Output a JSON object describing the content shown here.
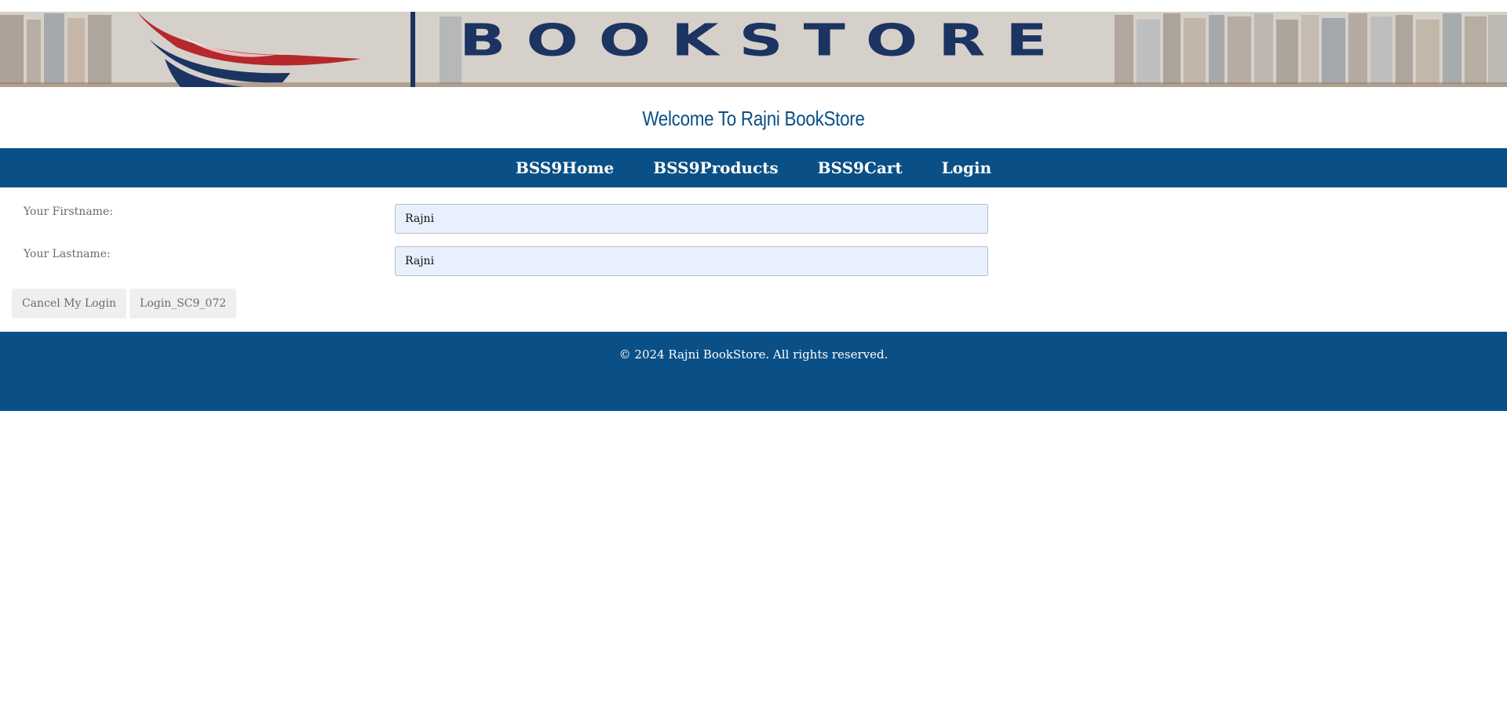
{
  "banner": {
    "logo_text": "BOOKSTORE",
    "colors": {
      "navy": "#1b3462",
      "red": "#b5282c"
    }
  },
  "welcome": {
    "title": "Welcome To Rajni BookStore"
  },
  "nav": {
    "items": [
      {
        "label": "BSS9Home"
      },
      {
        "label": "BSS9Products"
      },
      {
        "label": "BSS9Cart"
      },
      {
        "label": "Login"
      }
    ]
  },
  "form": {
    "firstname": {
      "label": "Your Firstname:",
      "value": "Rajni"
    },
    "lastname": {
      "label": "Your Lastname:",
      "value": "Rajni"
    }
  },
  "buttons": {
    "cancel_label": "Cancel My Login",
    "login_label": "Login_SC9_072"
  },
  "footer": {
    "copyright": "© 2024 Rajni BookStore. All rights reserved."
  },
  "theme": {
    "primary": "#0a5086",
    "input_bg": "#e8f0fe"
  }
}
